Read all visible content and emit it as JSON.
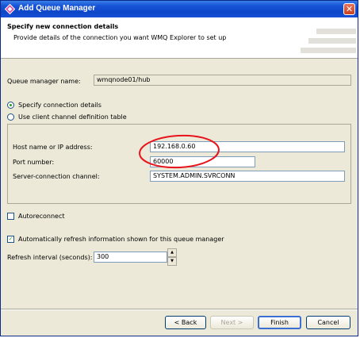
{
  "window": {
    "title": "Add Queue Manager",
    "close_glyph": "✕"
  },
  "header": {
    "title": "Specify new connection details",
    "description": "Provide details of the connection you want WMQ Explorer to set up"
  },
  "queue_manager": {
    "label": "Queue manager name:",
    "value": "wmqnode01/hub"
  },
  "connection_options": {
    "specify_label": "Specify connection details",
    "specify_selected": true,
    "ccdt_label": "Use client channel definition table",
    "ccdt_selected": false
  },
  "connection": {
    "host_label": "Host name or IP address:",
    "host_value": "192.168.0.60",
    "port_label": "Port number:",
    "port_value": "60000",
    "channel_label": "Server-connection channel:",
    "channel_value": "SYSTEM.ADMIN.SVRCONN"
  },
  "autoreconnect": {
    "label": "Autoreconnect",
    "checked": false
  },
  "auto_refresh": {
    "label": "Automatically refresh information shown for this queue manager",
    "checked": true,
    "check_glyph": "✓"
  },
  "refresh_interval": {
    "label": "Refresh interval (seconds):",
    "value": "300",
    "up_glyph": "▲",
    "down_glyph": "▼"
  },
  "buttons": {
    "back": "< Back",
    "next": "Next >",
    "finish": "Finish",
    "cancel": "Cancel"
  },
  "colors": {
    "title_bar": "#0e46c8",
    "dialog_bg": "#ece9d8",
    "annotation_circle": "#e8141c",
    "radio_dot": "#21a121"
  }
}
